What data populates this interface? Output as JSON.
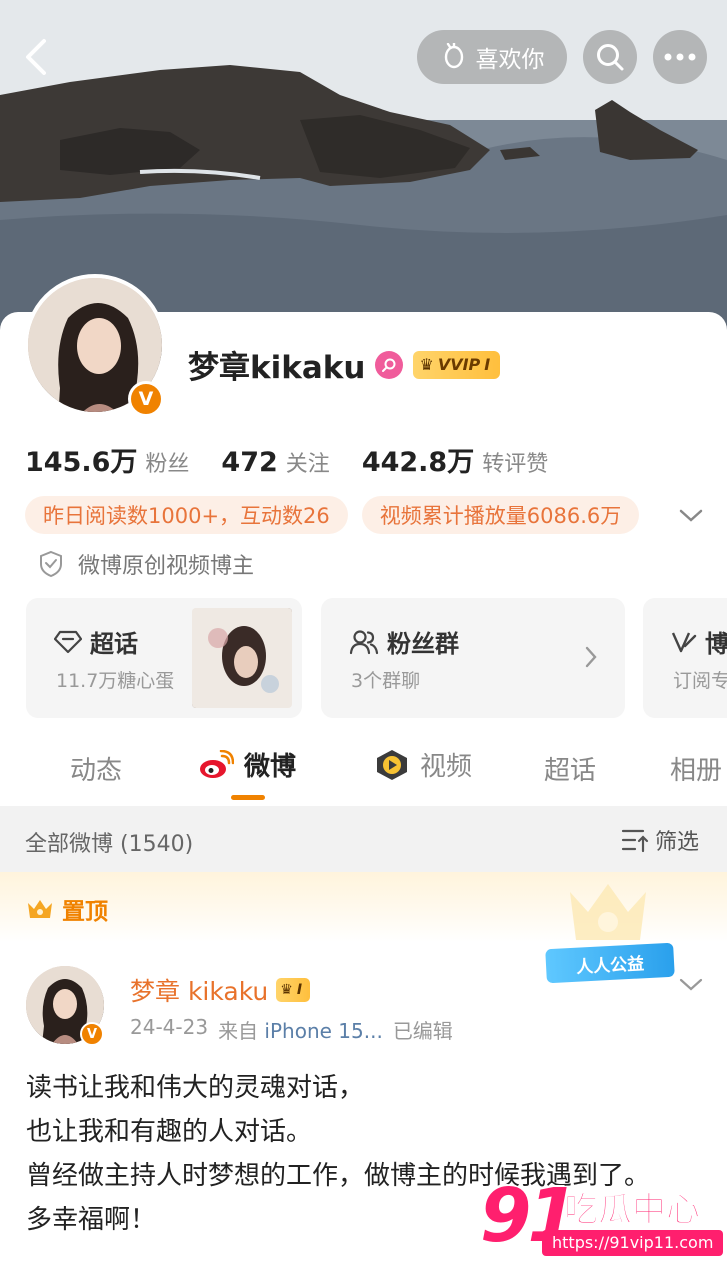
{
  "header": {
    "like_label": "喜欢你"
  },
  "profile": {
    "name": "梦章kikaku",
    "vip_label": "VVIP",
    "vip_level": "I",
    "stats": [
      {
        "value": "145.6万",
        "label": "粉丝"
      },
      {
        "value": "472",
        "label": "关注"
      },
      {
        "value": "442.8万",
        "label": "转评赞"
      }
    ],
    "tags": [
      "昨日阅读数1000+，互动数26",
      "视频累计播放量6086.6万"
    ],
    "verification": "微博原创视频博主"
  },
  "tiles": [
    {
      "title": "超话",
      "subtitle": "11.7万糖心蛋"
    },
    {
      "title": "粉丝群",
      "subtitle": "3个群聊"
    },
    {
      "title": "博",
      "subtitle": "订阅专"
    }
  ],
  "tabs": [
    "动态",
    "微博",
    "视频",
    "超话",
    "相册"
  ],
  "active_tab": "微博",
  "filter": {
    "count_label": "全部微博 (1540)",
    "filter_label": "筛选"
  },
  "post": {
    "pinned_label": "置顶",
    "charity_badge": "人人公益",
    "author": "梦章 kikaku",
    "vip_level": "I",
    "date": "24-4-23",
    "source_prefix": "来自",
    "source": "iPhone 15...",
    "edited": "已编辑",
    "lines": [
      "读书让我和伟大的灵魂对话，",
      "也让我和有趣的人对话。",
      "曾经做主持人时梦想的工作，做博主的时候我遇到了。",
      "多幸福啊！"
    ]
  },
  "watermark": {
    "number": "91",
    "text": "吃瓜中心",
    "url": "https://91vip11.com"
  },
  "colors": {
    "accent": "#f08200",
    "tag_bg": "#fdefe6",
    "tag_text": "#e8743b",
    "link": "#5b7fa8"
  }
}
